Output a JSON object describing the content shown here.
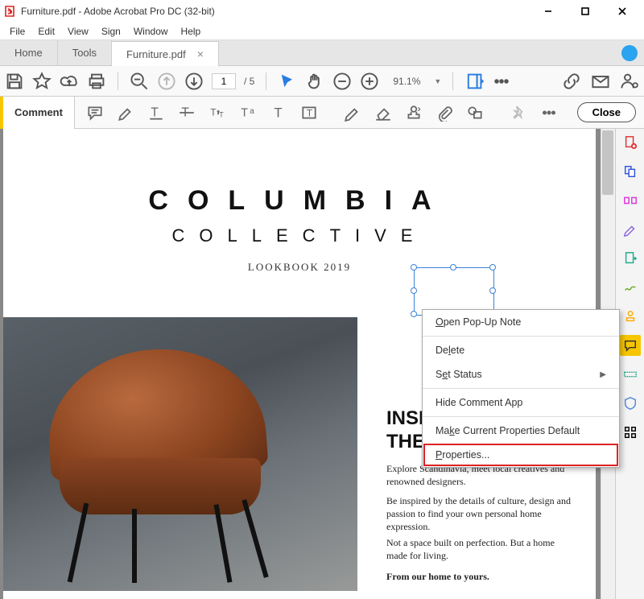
{
  "window": {
    "title": "Furniture.pdf - Adobe Acrobat Pro DC (32-bit)"
  },
  "menubar": {
    "items": [
      "File",
      "Edit",
      "View",
      "Sign",
      "Window",
      "Help"
    ]
  },
  "tabs": {
    "home": "Home",
    "tools": "Tools",
    "doc": "Furniture.pdf"
  },
  "toolbar": {
    "page_current": "1",
    "page_total": "/ 5",
    "zoom": "91.1%"
  },
  "comment_bar": {
    "label": "Comment",
    "close": "Close"
  },
  "document": {
    "brand_title": "COLUMBIA",
    "brand_sub": "COLLECTIVE",
    "lookbook": "LOOKBOOK 2019",
    "headline_l1": "INSP",
    "headline_l2": "THE",
    "para1": "Explore Scandinavia, meet local creatives and renowned designers.",
    "para2": "Be inspired by the details of culture, design and passion to find your own personal home expression.",
    "para3": "Not a space built on perfection. But a home made for living.",
    "para4": "From our home to yours."
  },
  "context_menu": {
    "open_popup": "Open Pop-Up Note",
    "delete": "Delete",
    "set_status": "Set Status",
    "hide_comment": "Hide Comment App",
    "make_default": "Make Current Properties Default",
    "properties": "Properties..."
  }
}
